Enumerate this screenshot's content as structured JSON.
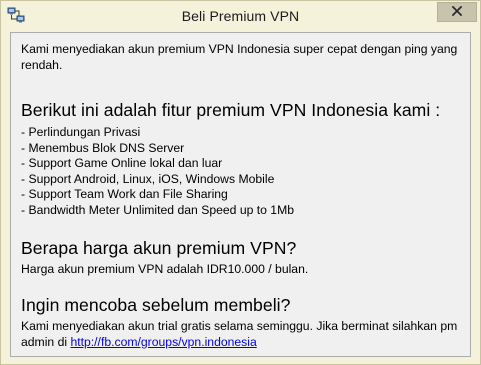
{
  "window": {
    "title": "Beli Premium VPN",
    "app_icon": "network-computers-icon",
    "close_icon": "close-icon"
  },
  "intro": {
    "text": "Kami menyediakan akun premium VPN Indonesia super cepat dengan ping yang rendah."
  },
  "features_section": {
    "heading": "Berikut ini adalah fitur premium VPN Indonesia kami :",
    "items": [
      "- Perlindungan Privasi",
      "- Menembus Blok DNS Server",
      "- Support Game Online lokal dan luar",
      "- Support Android, Linux, iOS, Windows Mobile",
      "- Support Team Work dan File Sharing",
      "- Bandwidth Meter Unlimited dan Speed up to 1Mb"
    ]
  },
  "price_section": {
    "heading": "Berapa harga akun premium VPN?",
    "text": "Harga akun premium VPN adalah IDR10.000 / bulan."
  },
  "trial_section": {
    "heading": "Ingin mencoba sebelum membeli?",
    "text": "Kami menyediakan akun trial gratis selama seminggu. Jika berminat silahkan pm admin di ",
    "link_text": "http://fb.com/groups/vpn.indonesia"
  }
}
